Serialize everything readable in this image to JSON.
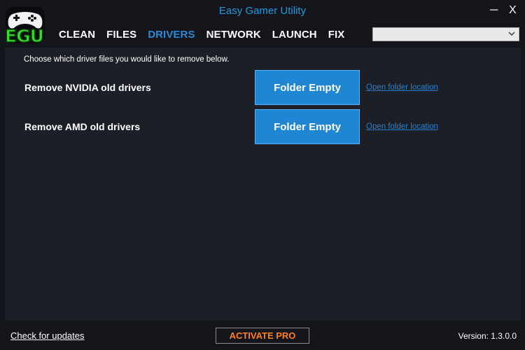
{
  "window": {
    "title": "Easy Gamer Utility",
    "minimize_glyph": "─",
    "close_glyph": "X"
  },
  "logo": {
    "text": "EGU",
    "text_color": "#36e02a",
    "icon": "gamepad-icon"
  },
  "nav": {
    "items": [
      {
        "label": "CLEAN",
        "active": false
      },
      {
        "label": "FILES",
        "active": false
      },
      {
        "label": "DRIVERS",
        "active": true
      },
      {
        "label": "NETWORK",
        "active": false
      },
      {
        "label": "LAUNCH",
        "active": false
      },
      {
        "label": "FIX",
        "active": false
      }
    ],
    "active_color": "#2a8ad8"
  },
  "dropdown": {
    "selected": "",
    "icon": "chevron-down-icon"
  },
  "drivers": {
    "intro": "Choose which driver files you would like to remove below.",
    "rows": [
      {
        "label": "Remove NVIDIA old drivers",
        "button": "Folder Empty",
        "link": "Open folder location"
      },
      {
        "label": "Remove AMD old drivers",
        "button": "Folder Empty",
        "link": "Open folder location"
      }
    ]
  },
  "footer": {
    "check_updates": "Check for updates",
    "activate": "ACTIVATE PRO",
    "version": "Version: 1.3.0.0"
  },
  "colors": {
    "background": "#13151a",
    "panel": "#1d1f27",
    "accent": "#1f86d4",
    "activate": "#ff7f1e"
  }
}
